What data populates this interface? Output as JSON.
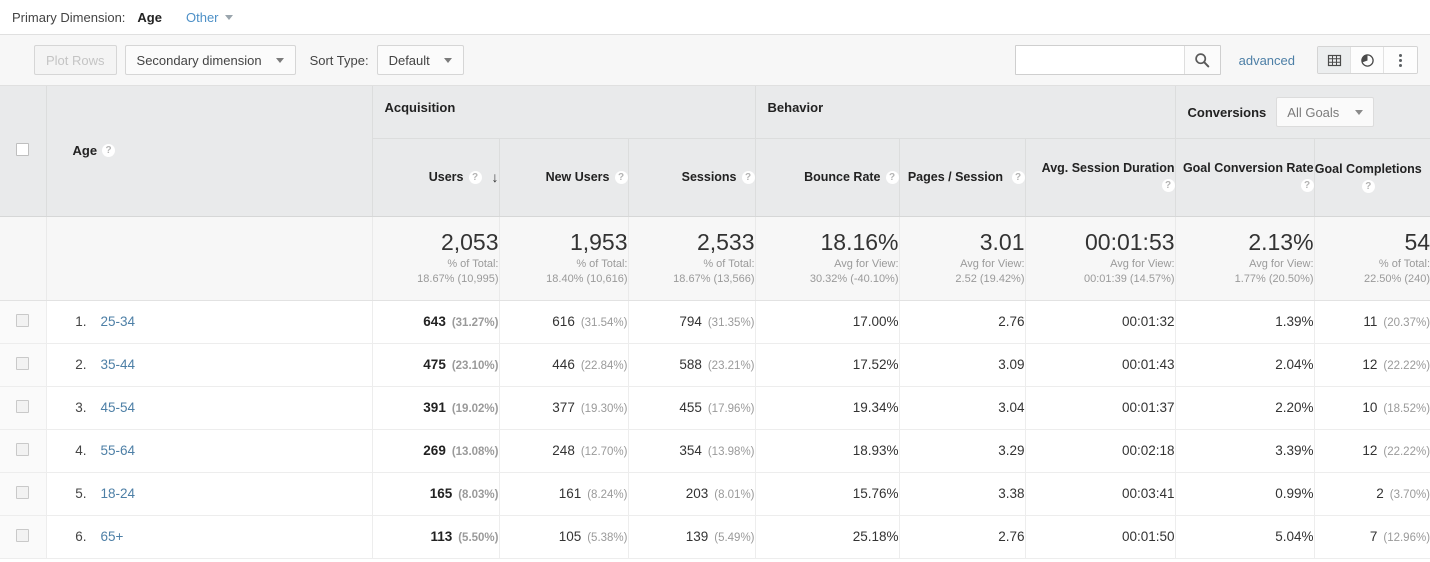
{
  "primary_dimension": {
    "label": "Primary Dimension:",
    "active": "Age",
    "other": "Other"
  },
  "toolbar": {
    "plot_rows": "Plot Rows",
    "secondary_dimension": "Secondary dimension",
    "sort_type_label": "Sort Type:",
    "sort_type_value": "Default",
    "search_value": "",
    "search_placeholder": "",
    "advanced": "advanced",
    "view_table_icon": "table-view-icon",
    "view_pie_icon": "pie-chart-view-icon",
    "view_more_icon": "more-options-icon"
  },
  "table": {
    "groups": {
      "dimension": "Age",
      "acquisition": "Acquisition",
      "behavior": "Behavior",
      "conversions": "Conversions",
      "goals_select": "All Goals"
    },
    "columns": [
      "Users",
      "New Users",
      "Sessions",
      "Bounce Rate",
      "Pages / Session",
      "Avg. Session Duration",
      "Goal Conversion Rate",
      "Goal Completions"
    ],
    "sorted_column": "Users",
    "sort_direction": "desc",
    "summary": [
      {
        "value": "2,053",
        "line1": "% of Total:",
        "line2": "18.67% (10,995)"
      },
      {
        "value": "1,953",
        "line1": "% of Total:",
        "line2": "18.40% (10,616)"
      },
      {
        "value": "2,533",
        "line1": "% of Total:",
        "line2": "18.67% (13,566)"
      },
      {
        "value": "18.16%",
        "line1": "Avg for View:",
        "line2": "30.32% (-40.10%)"
      },
      {
        "value": "3.01",
        "line1": "Avg for View:",
        "line2": "2.52 (19.42%)"
      },
      {
        "value": "00:01:53",
        "line1": "Avg for View:",
        "line2": "00:01:39 (14.57%)"
      },
      {
        "value": "2.13%",
        "line1": "Avg for View:",
        "line2": "1.77% (20.50%)"
      },
      {
        "value": "54",
        "line1": "% of Total:",
        "line2": "22.50% (240)"
      }
    ],
    "rows": [
      {
        "index": "1.",
        "dimension": "25-34",
        "users": "643",
        "users_pct": "(31.27%)",
        "new_users": "616",
        "new_users_pct": "(31.54%)",
        "sessions": "794",
        "sessions_pct": "(31.35%)",
        "bounce_rate": "17.00%",
        "pages_session": "2.76",
        "avg_duration": "00:01:32",
        "goal_rate": "1.39%",
        "goal_completions": "11",
        "goal_completions_pct": "(20.37%)"
      },
      {
        "index": "2.",
        "dimension": "35-44",
        "users": "475",
        "users_pct": "(23.10%)",
        "new_users": "446",
        "new_users_pct": "(22.84%)",
        "sessions": "588",
        "sessions_pct": "(23.21%)",
        "bounce_rate": "17.52%",
        "pages_session": "3.09",
        "avg_duration": "00:01:43",
        "goal_rate": "2.04%",
        "goal_completions": "12",
        "goal_completions_pct": "(22.22%)"
      },
      {
        "index": "3.",
        "dimension": "45-54",
        "users": "391",
        "users_pct": "(19.02%)",
        "new_users": "377",
        "new_users_pct": "(19.30%)",
        "sessions": "455",
        "sessions_pct": "(17.96%)",
        "bounce_rate": "19.34%",
        "pages_session": "3.04",
        "avg_duration": "00:01:37",
        "goal_rate": "2.20%",
        "goal_completions": "10",
        "goal_completions_pct": "(18.52%)"
      },
      {
        "index": "4.",
        "dimension": "55-64",
        "users": "269",
        "users_pct": "(13.08%)",
        "new_users": "248",
        "new_users_pct": "(12.70%)",
        "sessions": "354",
        "sessions_pct": "(13.98%)",
        "bounce_rate": "18.93%",
        "pages_session": "3.29",
        "avg_duration": "00:02:18",
        "goal_rate": "3.39%",
        "goal_completions": "12",
        "goal_completions_pct": "(22.22%)"
      },
      {
        "index": "5.",
        "dimension": "18-24",
        "users": "165",
        "users_pct": "(8.03%)",
        "new_users": "161",
        "new_users_pct": "(8.24%)",
        "sessions": "203",
        "sessions_pct": "(8.01%)",
        "bounce_rate": "15.76%",
        "pages_session": "3.38",
        "avg_duration": "00:03:41",
        "goal_rate": "0.99%",
        "goal_completions": "2",
        "goal_completions_pct": "(3.70%)"
      },
      {
        "index": "6.",
        "dimension": "65+",
        "users": "113",
        "users_pct": "(5.50%)",
        "new_users": "105",
        "new_users_pct": "(5.38%)",
        "sessions": "139",
        "sessions_pct": "(5.49%)",
        "bounce_rate": "25.18%",
        "pages_session": "2.76",
        "avg_duration": "00:01:50",
        "goal_rate": "5.04%",
        "goal_completions": "7",
        "goal_completions_pct": "(12.96%)"
      }
    ]
  },
  "colors": {
    "link": "#4d7fa6",
    "header_bg": "#e9eaeb",
    "toolbar_bg": "#f7f7f7",
    "summary_bg": "#f7f7f7"
  }
}
